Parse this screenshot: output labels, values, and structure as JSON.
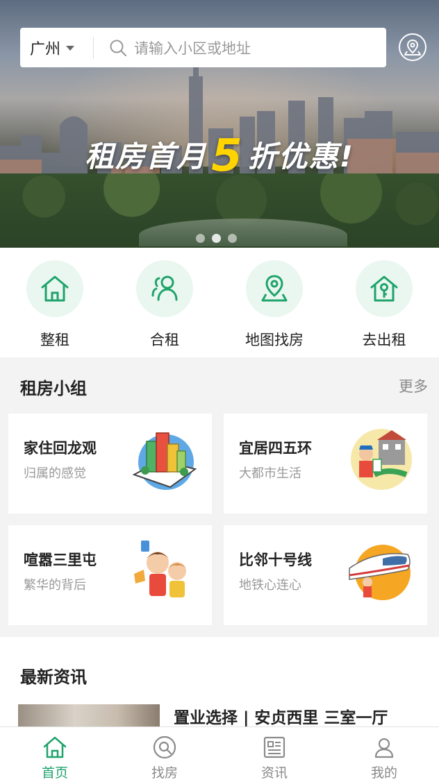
{
  "search": {
    "city": "广州",
    "placeholder": "请输入小区或地址"
  },
  "banner": {
    "title_before": "租房首月",
    "title_highlight": "5",
    "title_after": "折优惠!",
    "slide_count": 3,
    "active_slide": 1
  },
  "quick_nav": [
    {
      "label": "整租",
      "icon": "house-icon"
    },
    {
      "label": "合租",
      "icon": "people-icon"
    },
    {
      "label": "地图找房",
      "icon": "map-pin-icon"
    },
    {
      "label": "去出租",
      "icon": "house-key-icon"
    }
  ],
  "groups": {
    "title": "租房小组",
    "more": "更多",
    "items": [
      {
        "title": "家住回龙观",
        "subtitle": "归属的感觉",
        "icon": "buildings-illustration"
      },
      {
        "title": "宜居四五环",
        "subtitle": "大都市生活",
        "icon": "person-house-illustration"
      },
      {
        "title": "喧嚣三里屯",
        "subtitle": "繁华的背后",
        "icon": "couple-illustration"
      },
      {
        "title": "比邻十号线",
        "subtitle": "地铁心连心",
        "icon": "train-illustration"
      }
    ]
  },
  "news": {
    "title": "最新资讯",
    "items": [
      {
        "title": "置业选择 | 安贞西里 三室一厅"
      }
    ]
  },
  "tabbar": [
    {
      "label": "首页",
      "active": true,
      "icon": "home-icon"
    },
    {
      "label": "找房",
      "active": false,
      "icon": "find-icon"
    },
    {
      "label": "资讯",
      "active": false,
      "icon": "news-icon"
    },
    {
      "label": "我的",
      "active": false,
      "icon": "profile-icon"
    }
  ],
  "colors": {
    "accent": "#1fa36b",
    "highlight": "#ffd400"
  }
}
